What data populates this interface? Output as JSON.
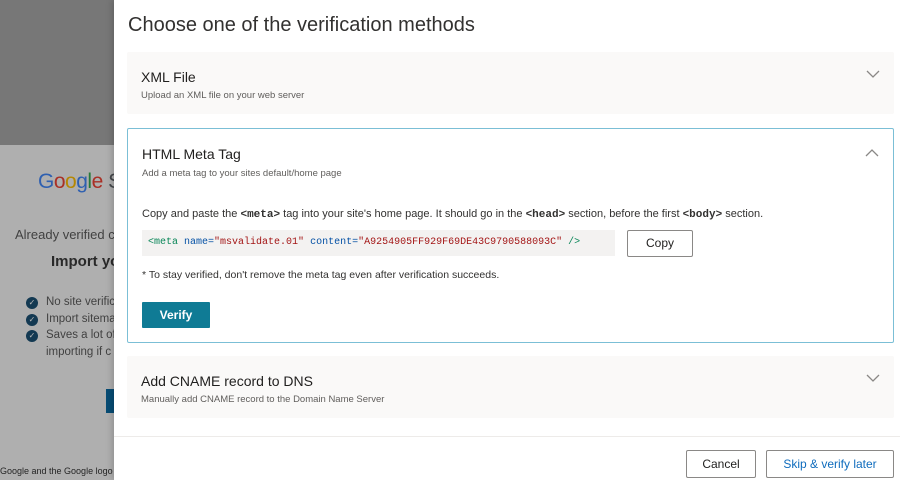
{
  "background": {
    "logo_letters": [
      "G",
      "o",
      "o",
      "g",
      "l",
      "e",
      " S"
    ],
    "already_verified": "Already verified c",
    "import_heading": "Import yo",
    "list_items": [
      "No site verific",
      "Import sitema",
      "Saves a lot of"
    ],
    "list_continuation": "importing if c",
    "footer": "Google and the Google logo"
  },
  "panel": {
    "title": "Choose one of the verification methods",
    "methods": [
      {
        "title": "XML File",
        "subtitle": "Upload an XML file on your web server"
      },
      {
        "title": "HTML Meta Tag",
        "subtitle": "Add a meta tag to your sites default/home page"
      },
      {
        "title": "Add CNAME record to DNS",
        "subtitle": "Manually add CNAME record to the Domain Name Server"
      }
    ],
    "meta": {
      "instruction_parts": [
        "Copy and paste the ",
        "<meta>",
        " tag into your site's home page. It should go in the ",
        "<head>",
        " section, before the first ",
        "<body>",
        " section."
      ],
      "code": {
        "open": "<meta",
        "name_attr": "name=",
        "name_val": "\"msvalidate.01\"",
        "content_attr": "content=",
        "content_val": "\"A9254905FF929F69DE43C9790588093C\"",
        "close": "/>"
      },
      "copy_label": "Copy",
      "note": "* To stay verified, don't remove the meta tag even after verification succeeds.",
      "verify_label": "Verify"
    },
    "footer": {
      "cancel_label": "Cancel",
      "skip_label": "Skip & verify later"
    }
  },
  "colors": {
    "accent": "#0f7b95",
    "expanded_border": "#7bbfd6",
    "skip_text": "#0f6cbd"
  }
}
